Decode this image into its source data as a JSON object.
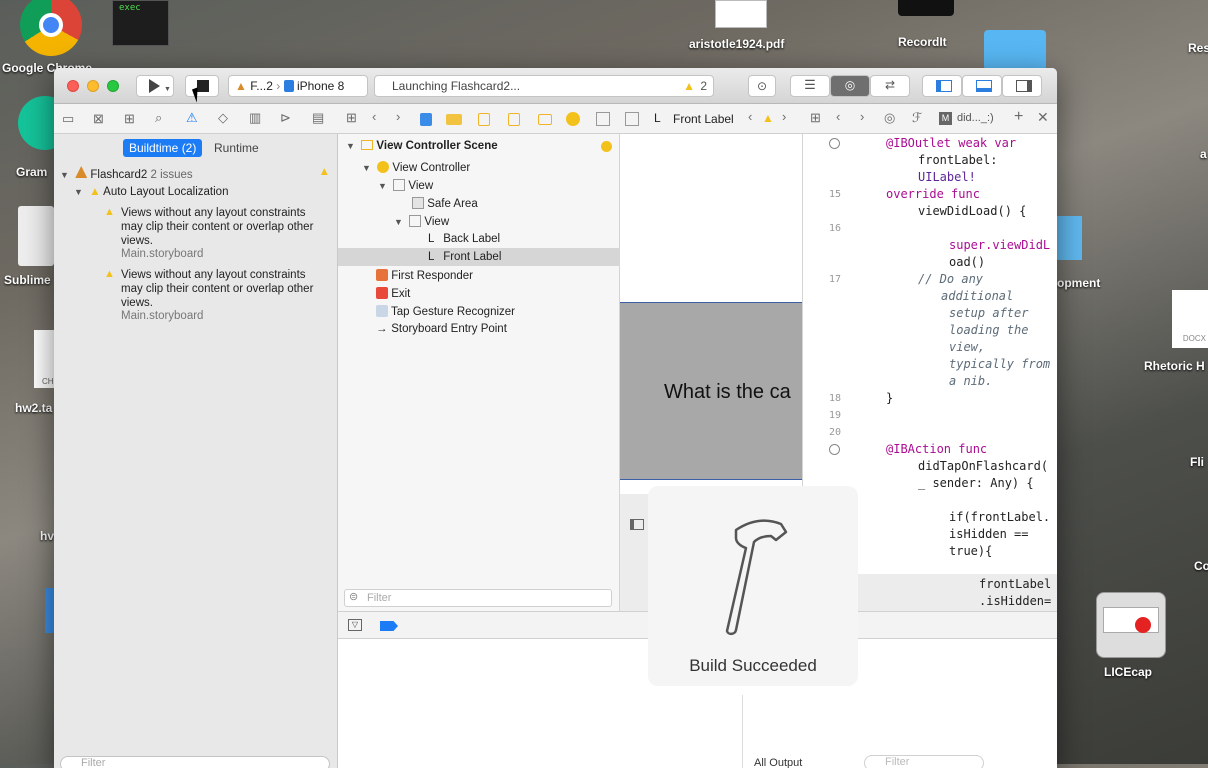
{
  "desktop": {
    "icons": [
      {
        "label": "Google Chrome"
      },
      {
        "label": "exec"
      },
      {
        "label": "aristotle1924.pdf"
      },
      {
        "label": "RecordIt"
      },
      {
        "label": "Res"
      },
      {
        "label": "Gram"
      },
      {
        "label": "Sublime"
      },
      {
        "label": "hw2.ta"
      },
      {
        "label": "hv"
      },
      {
        "label": "opment"
      },
      {
        "label": "DOCX"
      },
      {
        "label": "Rhetoric H"
      },
      {
        "label": "Fli"
      },
      {
        "label": "Co"
      },
      {
        "label": "LICEcap"
      },
      {
        "label": "a"
      },
      {
        "label": "CH"
      }
    ]
  },
  "toolbar": {
    "scheme": "F...2",
    "device": "iPhone 8",
    "status": "Launching Flashcard2...",
    "warning_count": "2"
  },
  "navigator": {
    "tabs": [
      {
        "label": "Buildtime (2)",
        "active": true
      },
      {
        "label": "Runtime",
        "active": false
      }
    ],
    "project": "Flashcard2",
    "issue_count": "2 issues",
    "group": "Auto Layout Localization",
    "issues": [
      {
        "message": "Views without any layout constraints may clip their content or overlap other views.",
        "file": "Main.storyboard"
      },
      {
        "message": "Views without any layout constraints may clip their content or overlap other views.",
        "file": "Main.storyboard"
      }
    ],
    "filter_placeholder": "Filter"
  },
  "breadcrumb": {
    "last": "Front Label",
    "assistant": "did..._:)"
  },
  "outline": {
    "scene": "View Controller Scene",
    "items": [
      {
        "label": "View Controller"
      },
      {
        "label": "View"
      },
      {
        "label": "Safe Area"
      },
      {
        "label": "View"
      },
      {
        "label": "Back Label"
      },
      {
        "label": "Front Label"
      },
      {
        "label": "First Responder"
      },
      {
        "label": "Exit"
      },
      {
        "label": "Tap Gesture Recognizer"
      },
      {
        "label": "Storyboard Entry Point"
      }
    ],
    "filter_placeholder": "Filter"
  },
  "canvas": {
    "label_text": "What is the ca"
  },
  "editor": {
    "lines": [
      {
        "num": "",
        "text": "@IBOutlet weak var"
      },
      {
        "num": "",
        "text": "frontLabel:"
      },
      {
        "num": "",
        "text": "UILabel!"
      },
      {
        "num": "15",
        "text": "override func"
      },
      {
        "num": "",
        "text": "viewDidLoad() {"
      },
      {
        "num": "16",
        "text": "super.viewDidL"
      },
      {
        "num": "",
        "text": "oad()"
      },
      {
        "num": "17",
        "text": "// Do any"
      },
      {
        "num": "",
        "text": "additional"
      },
      {
        "num": "",
        "text": "setup after"
      },
      {
        "num": "",
        "text": "loading the"
      },
      {
        "num": "",
        "text": "view,"
      },
      {
        "num": "",
        "text": "typically from"
      },
      {
        "num": "",
        "text": "a nib."
      },
      {
        "num": "18",
        "text": "}"
      },
      {
        "num": "19",
        "text": ""
      },
      {
        "num": "20",
        "text": ""
      },
      {
        "num": "",
        "text": "@IBAction func"
      },
      {
        "num": "",
        "text": "didTapOnFlashcard("
      },
      {
        "num": "",
        "text": "_ sender: Any) {"
      },
      {
        "num": "",
        "text": "if(frontLabel."
      },
      {
        "num": "",
        "text": "isHidden =="
      },
      {
        "num": "",
        "text": "true){"
      },
      {
        "num": "",
        "text": "frontLabel"
      },
      {
        "num": "",
        "text": ".isHidden="
      }
    ]
  },
  "hud": {
    "text": "Build Succeeded"
  },
  "debug": {
    "all_output": "All Output",
    "filter_placeholder": "Filter"
  },
  "colors": {
    "accent": "#1b7cf5",
    "warning": "#f3c11b",
    "keyword": "#aa0d91",
    "comment": "#5d6c79"
  }
}
